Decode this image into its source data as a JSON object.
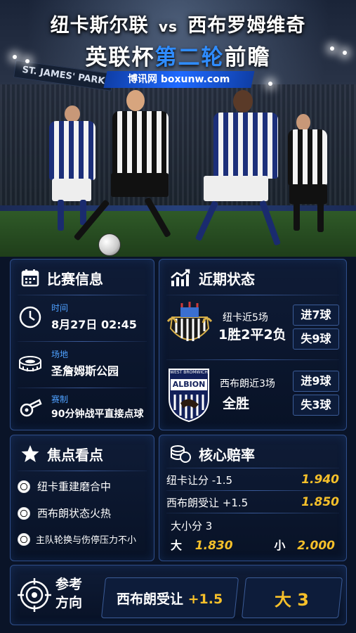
{
  "header": {
    "title_home": "纽卡斯尔联",
    "vs": "vs",
    "title_away": "西布罗姆维奇",
    "subtitle_pre": "英联杯",
    "subtitle_highlight": "第二轮",
    "subtitle_post": "前瞻",
    "site": "博讯网 boxunw.com",
    "stadium_sign": "ST. JAMES' PARK"
  },
  "match_info": {
    "title": "比赛信息",
    "icon": "calendar-icon",
    "items": [
      {
        "label": "时间",
        "value": "8月27日 02:45",
        "icon": "clock-icon"
      },
      {
        "label": "场地",
        "value": "圣詹姆斯公园",
        "icon": "stadium-icon"
      },
      {
        "label": "赛制",
        "value": "90分钟战平直接点球",
        "icon": "whistle-icon"
      }
    ]
  },
  "recent_form": {
    "title": "近期状态",
    "icon": "trend-chart-icon",
    "teams": [
      {
        "name": "纽卡近5场",
        "record": "1胜2平2负",
        "scored": "进7球",
        "conceded": "失9球",
        "badge": "newcastle-badge"
      },
      {
        "name": "西布朗近3场",
        "record": "全胜",
        "scored": "进9球",
        "conceded": "失3球",
        "badge": "west-brom-badge",
        "badge_text": "WEST BROMWICH",
        "badge_main": "ALBION"
      }
    ]
  },
  "focus": {
    "title": "焦点看点",
    "icon": "star-icon",
    "items": [
      "纽卡重建磨合中",
      "西布朗状态火热",
      "主队轮换与伤停压力不小"
    ]
  },
  "odds": {
    "title": "核心赔率",
    "icon": "coins-icon",
    "handicap_home_label": "纽卡让分 -1.5",
    "handicap_home_odds": "1.940",
    "handicap_away_label": "西布朗受让 +1.5",
    "handicap_away_odds": "1.850",
    "total_label": "大小分 3",
    "over_label": "大",
    "over_odds": "1.830",
    "under_label": "小",
    "under_odds": "2.000"
  },
  "reference": {
    "label_line1": "参考",
    "label_line2": "方向",
    "pick1_text": "西布朗受让",
    "pick1_value": "+1.5",
    "pick2": "大 3"
  },
  "colors": {
    "accent_blue": "#2f8cff",
    "gold": "#f6c02a",
    "panel_border": "#2f4e8a"
  }
}
